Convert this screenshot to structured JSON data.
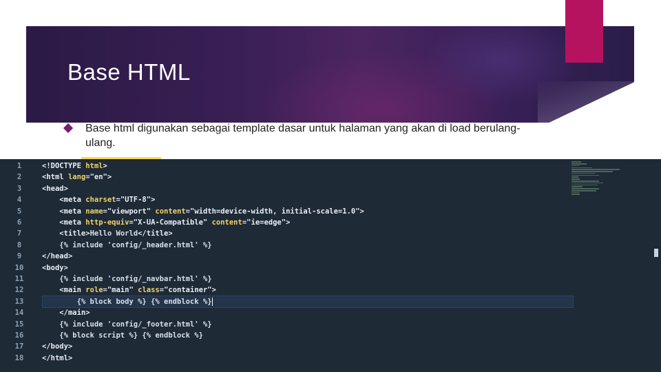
{
  "slide": {
    "title": "Base HTML",
    "bullet": "Base html digunakan sebagai template dasar untuk halaman yang akan di load berulang-ulang."
  },
  "editor": {
    "highlight_line": 13,
    "lines": [
      {
        "n": "1",
        "tokens": [
          [
            "tag",
            "<!DOCTYPE "
          ],
          [
            "attr",
            "html"
          ],
          [
            "tag",
            ">"
          ]
        ]
      },
      {
        "n": "2",
        "tokens": [
          [
            "tag",
            "<html "
          ],
          [
            "attr",
            "lang"
          ],
          [
            "eq",
            "="
          ],
          [
            "str",
            "\"en\""
          ],
          [
            "tag",
            ">"
          ]
        ]
      },
      {
        "n": "3",
        "tokens": [
          [
            "tag",
            "<head>"
          ]
        ]
      },
      {
        "n": "4",
        "tokens": [
          [
            "txt",
            "    "
          ],
          [
            "tag",
            "<meta "
          ],
          [
            "attr",
            "charset"
          ],
          [
            "eq",
            "="
          ],
          [
            "str",
            "\"UTF-8\""
          ],
          [
            "tag",
            ">"
          ]
        ]
      },
      {
        "n": "5",
        "tokens": [
          [
            "txt",
            "    "
          ],
          [
            "tag",
            "<meta "
          ],
          [
            "attr",
            "name"
          ],
          [
            "eq",
            "="
          ],
          [
            "str",
            "\"viewport\" "
          ],
          [
            "attr",
            "content"
          ],
          [
            "eq",
            "="
          ],
          [
            "str",
            "\"width=device-width, initial-scale=1.0\""
          ],
          [
            "tag",
            ">"
          ]
        ]
      },
      {
        "n": "6",
        "tokens": [
          [
            "txt",
            "    "
          ],
          [
            "tag",
            "<meta "
          ],
          [
            "attr",
            "http-equiv"
          ],
          [
            "eq",
            "="
          ],
          [
            "str",
            "\"X-UA-Compatible\" "
          ],
          [
            "attr",
            "content"
          ],
          [
            "eq",
            "="
          ],
          [
            "str",
            "\"ie=edge\""
          ],
          [
            "tag",
            ">"
          ]
        ]
      },
      {
        "n": "7",
        "tokens": [
          [
            "txt",
            "    "
          ],
          [
            "tag",
            "<title>"
          ],
          [
            "txt",
            "Hello World"
          ],
          [
            "tag",
            "</title>"
          ]
        ]
      },
      {
        "n": "8",
        "tokens": [
          [
            "txt",
            "    {% include 'config/_header.html' %}"
          ]
        ]
      },
      {
        "n": "9",
        "tokens": [
          [
            "tag",
            "</head>"
          ]
        ]
      },
      {
        "n": "10",
        "tokens": [
          [
            "tag",
            "<body>"
          ]
        ]
      },
      {
        "n": "11",
        "tokens": [
          [
            "txt",
            "    {% include 'config/_navbar.html' %}"
          ]
        ]
      },
      {
        "n": "12",
        "tokens": [
          [
            "txt",
            "    "
          ],
          [
            "tag",
            "<main "
          ],
          [
            "attr",
            "role"
          ],
          [
            "eq",
            "="
          ],
          [
            "str",
            "\"main\" "
          ],
          [
            "attr",
            "class"
          ],
          [
            "eq",
            "="
          ],
          [
            "str",
            "\"container\""
          ],
          [
            "tag",
            ">"
          ]
        ]
      },
      {
        "n": "13",
        "tokens": [
          [
            "txt",
            "        {% block body %} {% endblock %}"
          ]
        ]
      },
      {
        "n": "14",
        "tokens": [
          [
            "txt",
            "    "
          ],
          [
            "tag",
            "</main>"
          ]
        ]
      },
      {
        "n": "15",
        "tokens": [
          [
            "txt",
            "    {% include 'config/_footer.html' %}"
          ]
        ]
      },
      {
        "n": "16",
        "tokens": [
          [
            "txt",
            "    {% block script %} {% endblock %}"
          ]
        ]
      },
      {
        "n": "17",
        "tokens": [
          [
            "tag",
            "</body>"
          ]
        ]
      },
      {
        "n": "18",
        "tokens": [
          [
            "tag",
            "</html>"
          ]
        ]
      }
    ]
  }
}
